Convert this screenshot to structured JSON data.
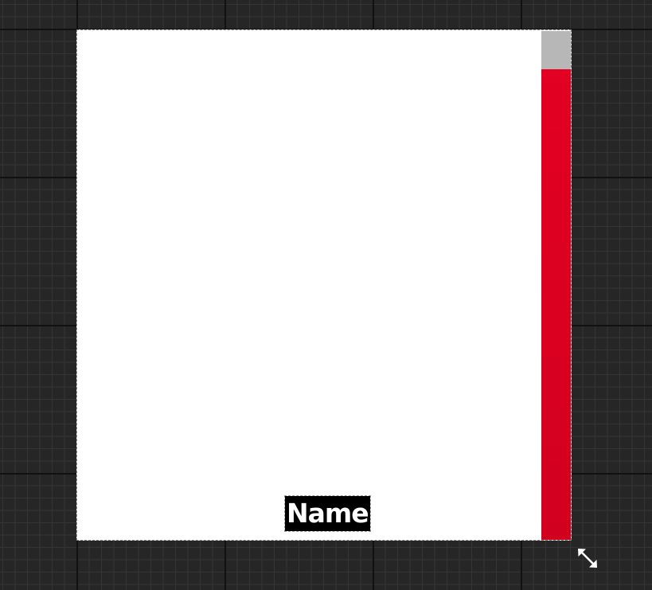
{
  "widget": {
    "name_label": "Name"
  },
  "progress_bar": {
    "percent": 92.5,
    "fill_color": "#e30022",
    "track_color": "#b7b7b7"
  },
  "canvas": {
    "background_color": "#262626",
    "widget_background": "#ffffff"
  },
  "icons": {
    "resize": "resize-diagonal-icon"
  }
}
